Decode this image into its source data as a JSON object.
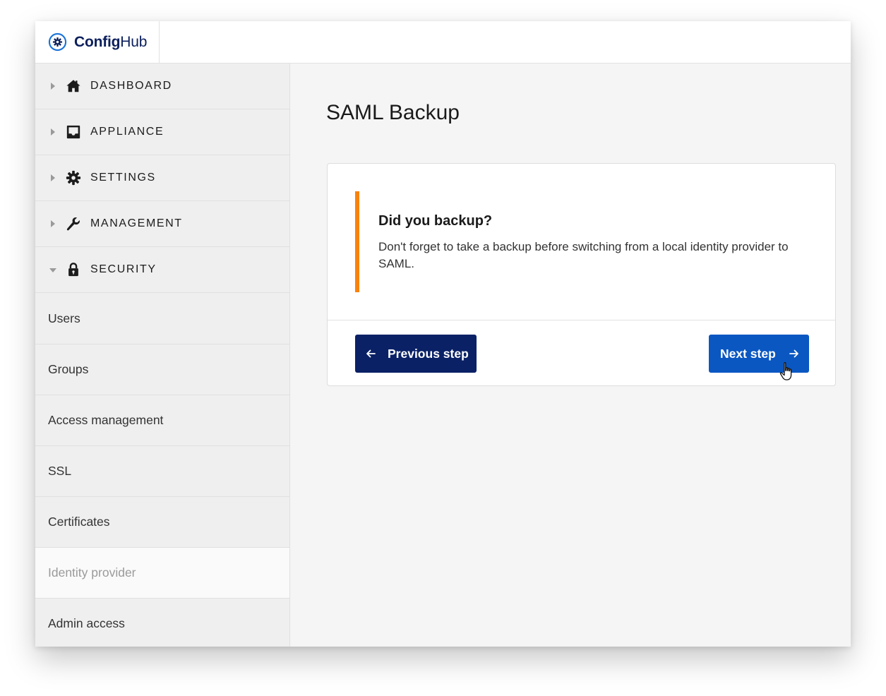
{
  "brand": {
    "name_bold": "Config",
    "name_regular": "Hub",
    "logo": "gear-circle-icon",
    "color": "#0b1f5c"
  },
  "sidebar": {
    "sections": [
      {
        "label": "DASHBOARD",
        "icon": "home-icon",
        "expanded": false
      },
      {
        "label": "APPLIANCE",
        "icon": "inbox-tray-icon",
        "expanded": false
      },
      {
        "label": "SETTINGS",
        "icon": "gear-icon",
        "expanded": false
      },
      {
        "label": "MANAGEMENT",
        "icon": "wrench-icon",
        "expanded": false
      },
      {
        "label": "SECURITY",
        "icon": "lock-icon",
        "expanded": true
      }
    ],
    "security_items": [
      {
        "label": "Users",
        "active": false
      },
      {
        "label": "Groups",
        "active": false
      },
      {
        "label": "Access management",
        "active": false
      },
      {
        "label": "SSL",
        "active": false
      },
      {
        "label": "Certificates",
        "active": false
      },
      {
        "label": "Identity provider",
        "active": true
      },
      {
        "label": "Admin access",
        "active": false
      }
    ]
  },
  "main": {
    "title": "SAML Backup",
    "notice": {
      "title": "Did you backup?",
      "text": "Don't forget to take a backup before switching from a local identity provider to SAML.",
      "accent_color": "#f7830d"
    },
    "buttons": {
      "previous": {
        "label": "Previous step",
        "icon": "arrow-left-icon",
        "color": "#0a2166"
      },
      "next": {
        "label": "Next step",
        "icon": "arrow-right-icon",
        "color": "#0a57c2"
      }
    }
  }
}
